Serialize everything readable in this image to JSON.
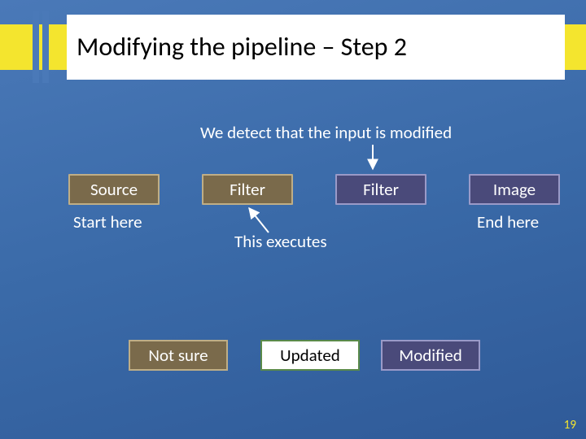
{
  "title": "Modifying the pipeline – Step 2",
  "subtitle": "We detect that the input is modified",
  "boxes": {
    "source": "Source",
    "filter1": "Filter",
    "filter2": "Filter",
    "image": "Image"
  },
  "labels": {
    "start": "Start here",
    "end": "End here",
    "exec": "This executes"
  },
  "legend": {
    "notsure": "Not sure",
    "updated": "Updated",
    "modified": "Modified"
  },
  "page": "19"
}
